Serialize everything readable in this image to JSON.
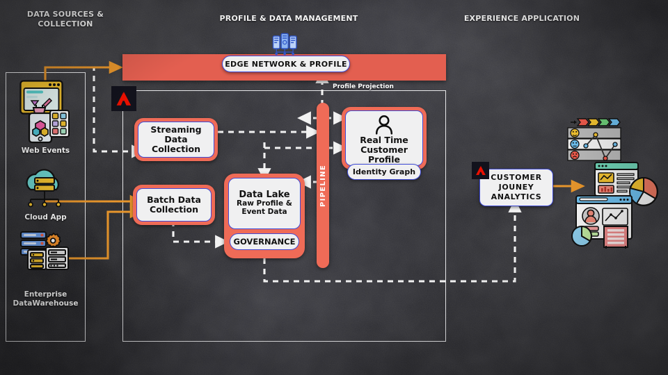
{
  "sections": [
    {
      "id": "sources",
      "title": "DATA SOURCES &\nCOLLECTION"
    },
    {
      "id": "profile",
      "title": "PROFILE & DATA MANAGEMENT"
    },
    {
      "id": "experience",
      "title": "EXPERIENCE APPLICATION"
    }
  ],
  "section_titles": {
    "sources_line1": "DATA SOURCES &",
    "sources_line2": "COLLECTION",
    "profile": "PROFILE & DATA MANAGEMENT",
    "experience": "EXPERIENCE APPLICATION"
  },
  "data_sources": [
    {
      "label_line1": "Web Events",
      "label_line2": "",
      "icon": "web-events-icon"
    },
    {
      "label_line1": "Cloud App",
      "label_line2": "",
      "icon": "cloud-app-icon"
    },
    {
      "label_line1": "Enterprise",
      "label_line2": "DataWarehouse",
      "icon": "enterprise-data-warehouse-icon"
    }
  ],
  "edge_bar": {
    "label": "EDGE NETWORK & PROFILE",
    "icon": "server-rack-icon",
    "color": "#e35f50"
  },
  "nodes": {
    "streaming": {
      "line1": "Streaming Data",
      "line2": "Collection"
    },
    "batch": {
      "line1": "Batch Data",
      "line2": "Collection"
    },
    "data_lake": {
      "line1": "Data Lake",
      "line2": "Raw Profile &",
      "line3": "Event Data"
    },
    "governance": {
      "label": "GOVERNANCE"
    },
    "profile": {
      "line1": "Real Time",
      "line2": "Customer Profile",
      "icon": "person-icon"
    },
    "identity_graph": {
      "label": "Identity Graph"
    },
    "cja": {
      "line1": "CUSTOMER",
      "line2": "JOUNEY",
      "line3": "ANALYTICS",
      "icon": "adobe-logo-icon"
    }
  },
  "pipeline": {
    "label": "PIPELINE",
    "color": "#ef6b57"
  },
  "annotations": {
    "profile_projection": "Profile Projection"
  },
  "experience_icons": [
    {
      "name": "journey-sentiment-chart-icon"
    },
    {
      "name": "analytics-dashboard-icon"
    },
    {
      "name": "customer-profile-dashboard-icon"
    }
  ],
  "colors": {
    "coral": "#ef6b57",
    "edge_bar": "#e35f50",
    "node_border_blue": "#3f4bd6",
    "node_fill": "#f0f0f1",
    "orange_arrow": "#e8962c",
    "dashed_white": "#f2f2f2",
    "adobe_red": "#eb1000",
    "adobe_bg": "#12121c",
    "background": "#2f2f33"
  }
}
